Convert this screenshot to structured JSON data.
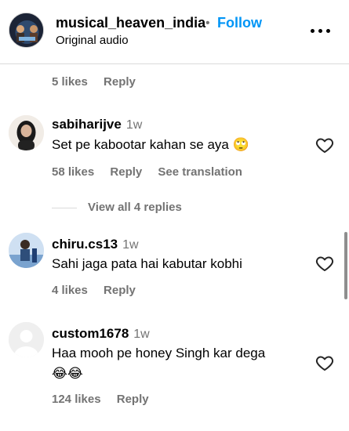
{
  "header": {
    "username": "musical_heaven_india",
    "separator": "•",
    "follow_label": "Follow",
    "subtitle": "Original audio",
    "more_icon": "more-horizontal-icon"
  },
  "top_meta": {
    "likes": "5 likes",
    "reply": "Reply"
  },
  "comments": [
    {
      "username": "sabiharijve",
      "time": "1w",
      "text": "Set pe kabootar kahan se aya",
      "emoji": "🙄",
      "likes": "58 likes",
      "reply": "Reply",
      "translate": "See translation",
      "view_replies": "View all 4 replies"
    },
    {
      "username": "chiru.cs13",
      "time": "1w",
      "text": "Sahi jaga pata hai kabutar kobhi",
      "likes": "4 likes",
      "reply": "Reply"
    },
    {
      "username": "custom1678",
      "time": "1w",
      "text": "Haa mooh pe honey Singh kar dega",
      "emoji_line": "😂😂",
      "likes": "124 likes",
      "reply": "Reply"
    }
  ],
  "colors": {
    "link": "#0095f6",
    "muted": "#737373",
    "divider": "#dbdbdb"
  }
}
